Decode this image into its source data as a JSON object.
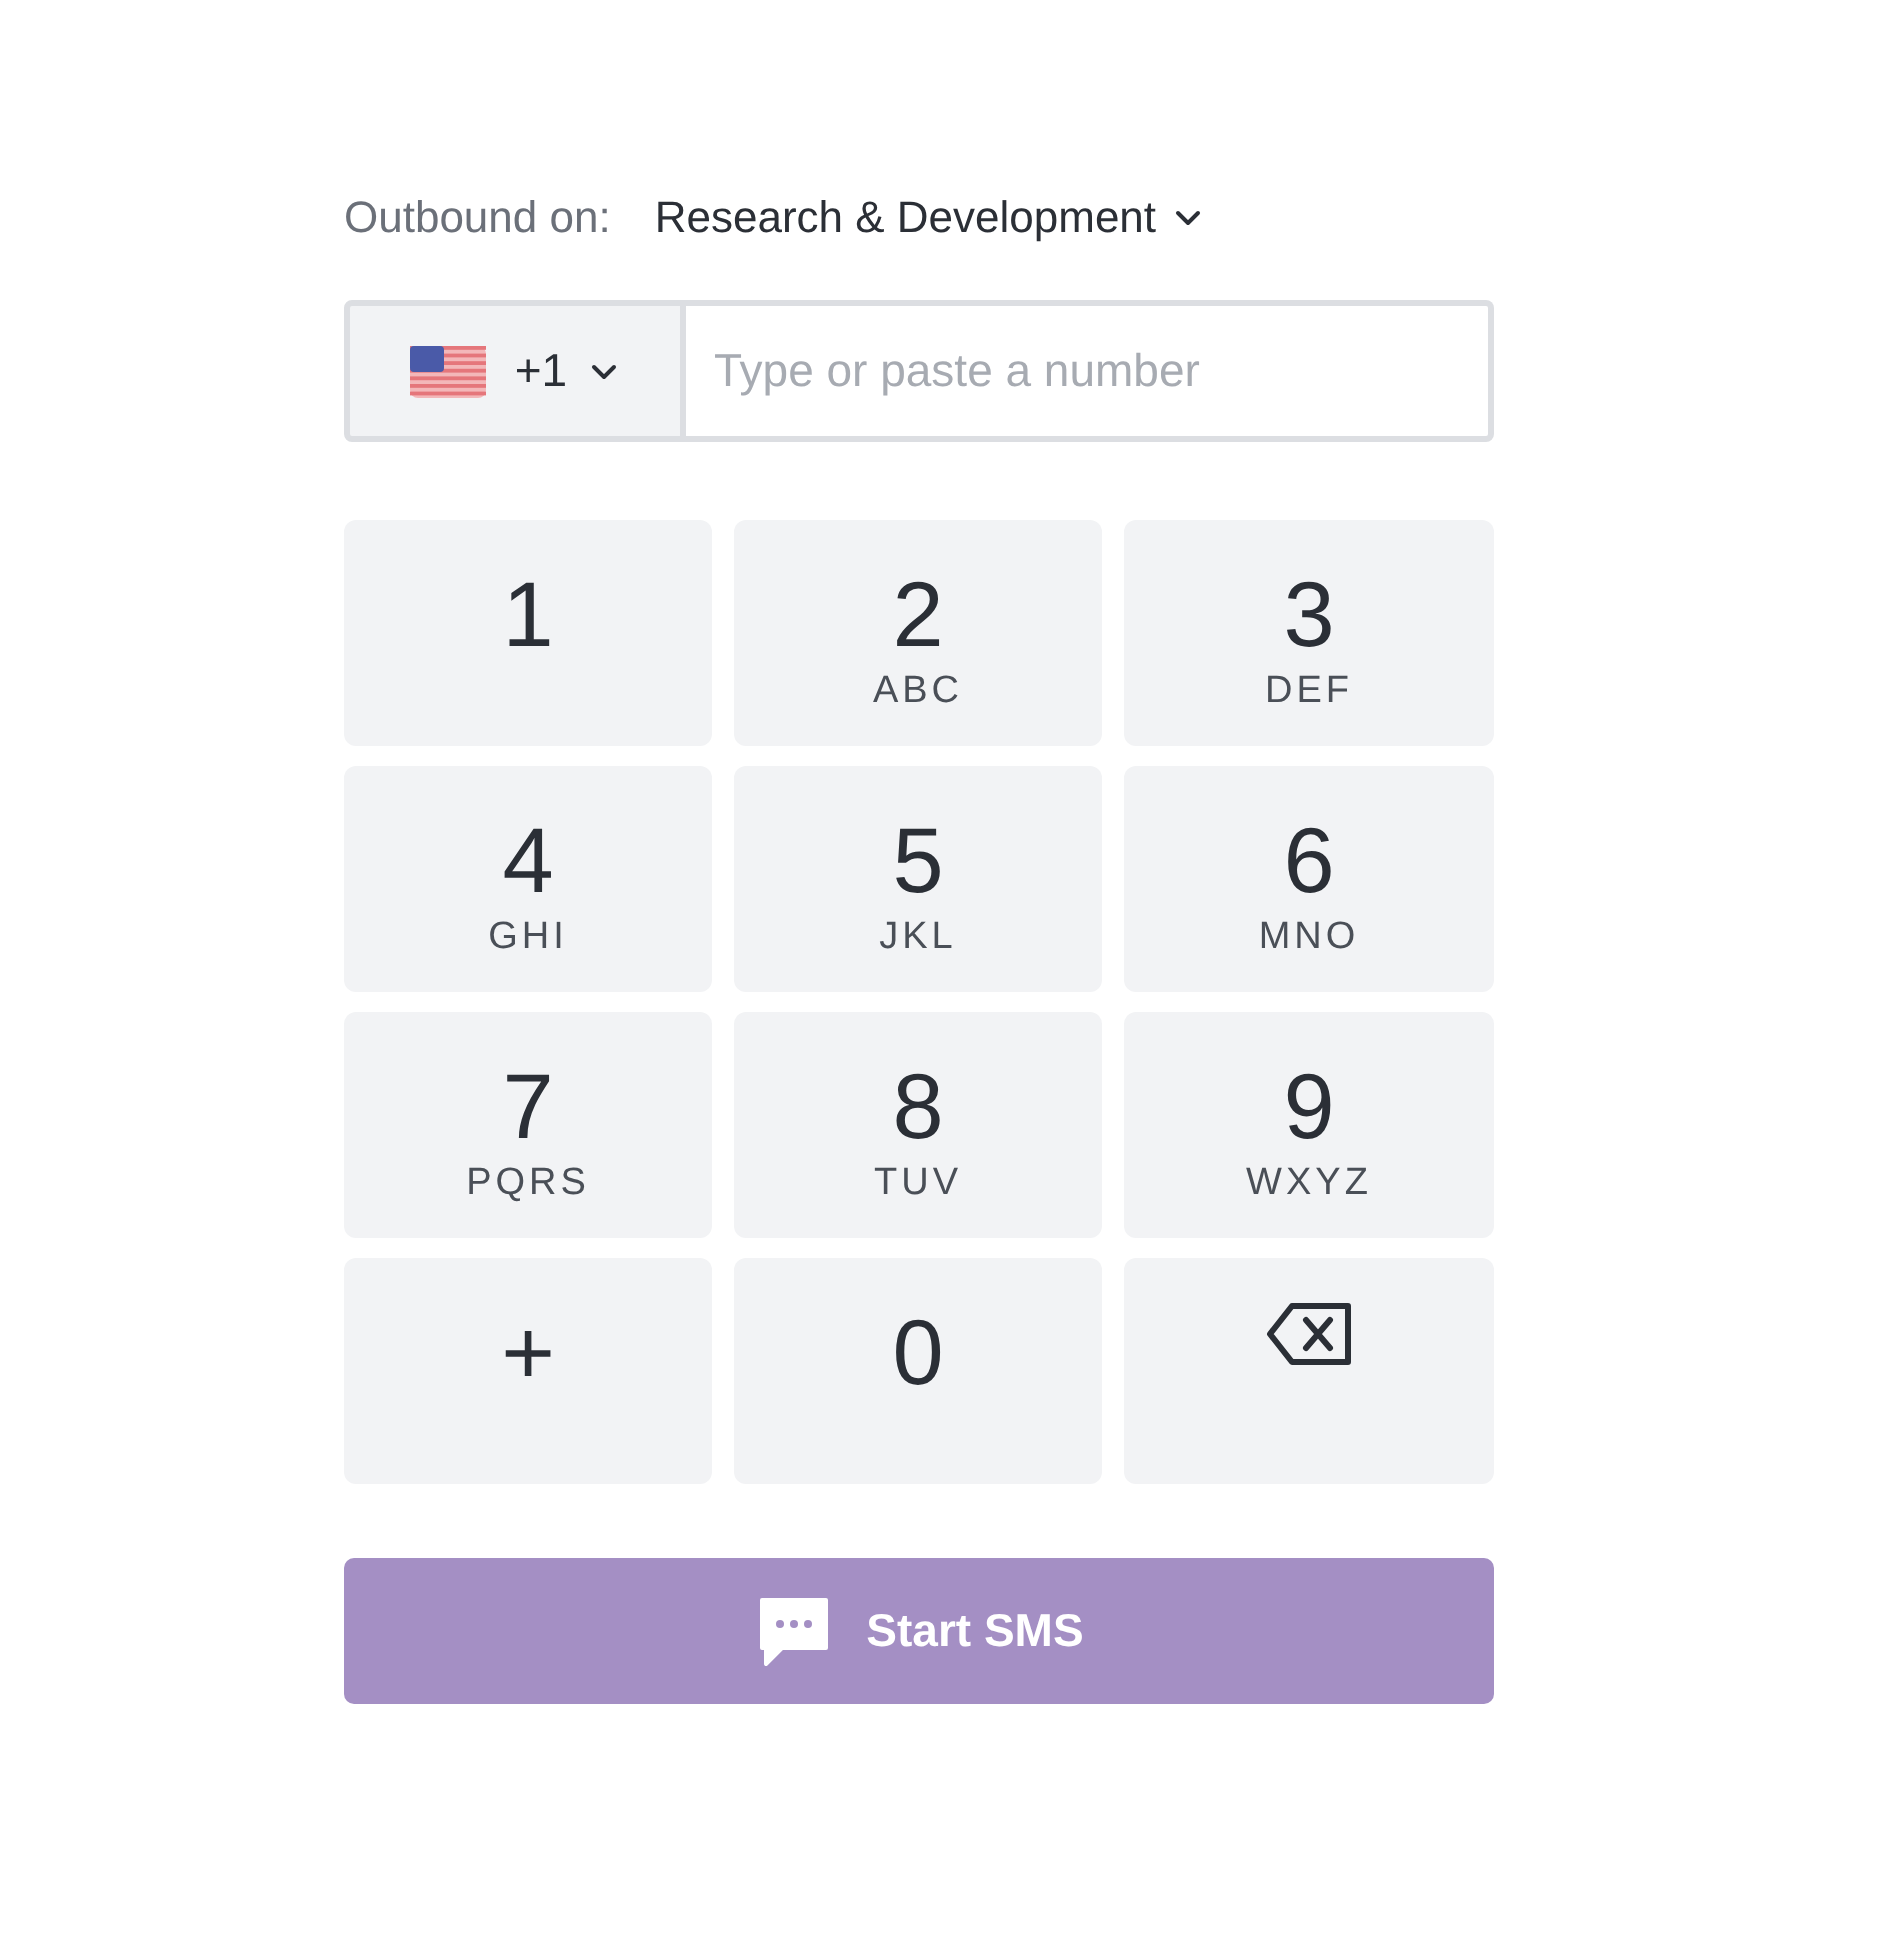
{
  "outbound": {
    "label": "Outbound on:",
    "value": "Research & Development"
  },
  "phone": {
    "country_code": "+1",
    "placeholder": "Type or paste a number"
  },
  "keys": [
    {
      "kind": "digit",
      "digit": "1"
    },
    {
      "kind": "digit",
      "digit": "2",
      "letters": "ABC"
    },
    {
      "kind": "digit",
      "digit": "3",
      "letters": "DEF"
    },
    {
      "kind": "digit",
      "digit": "4",
      "letters": "GHI"
    },
    {
      "kind": "digit",
      "digit": "5",
      "letters": "JKL"
    },
    {
      "kind": "digit",
      "digit": "6",
      "letters": "MNO"
    },
    {
      "kind": "digit",
      "digit": "7",
      "letters": "PQRS"
    },
    {
      "kind": "digit",
      "digit": "8",
      "letters": "TUV"
    },
    {
      "kind": "digit",
      "digit": "9",
      "letters": "WXYZ"
    },
    {
      "kind": "digit",
      "digit": "+"
    },
    {
      "kind": "digit",
      "digit": "0"
    },
    {
      "kind": "backspace"
    }
  ],
  "start_button": {
    "label": "Start SMS",
    "disabled": true
  }
}
